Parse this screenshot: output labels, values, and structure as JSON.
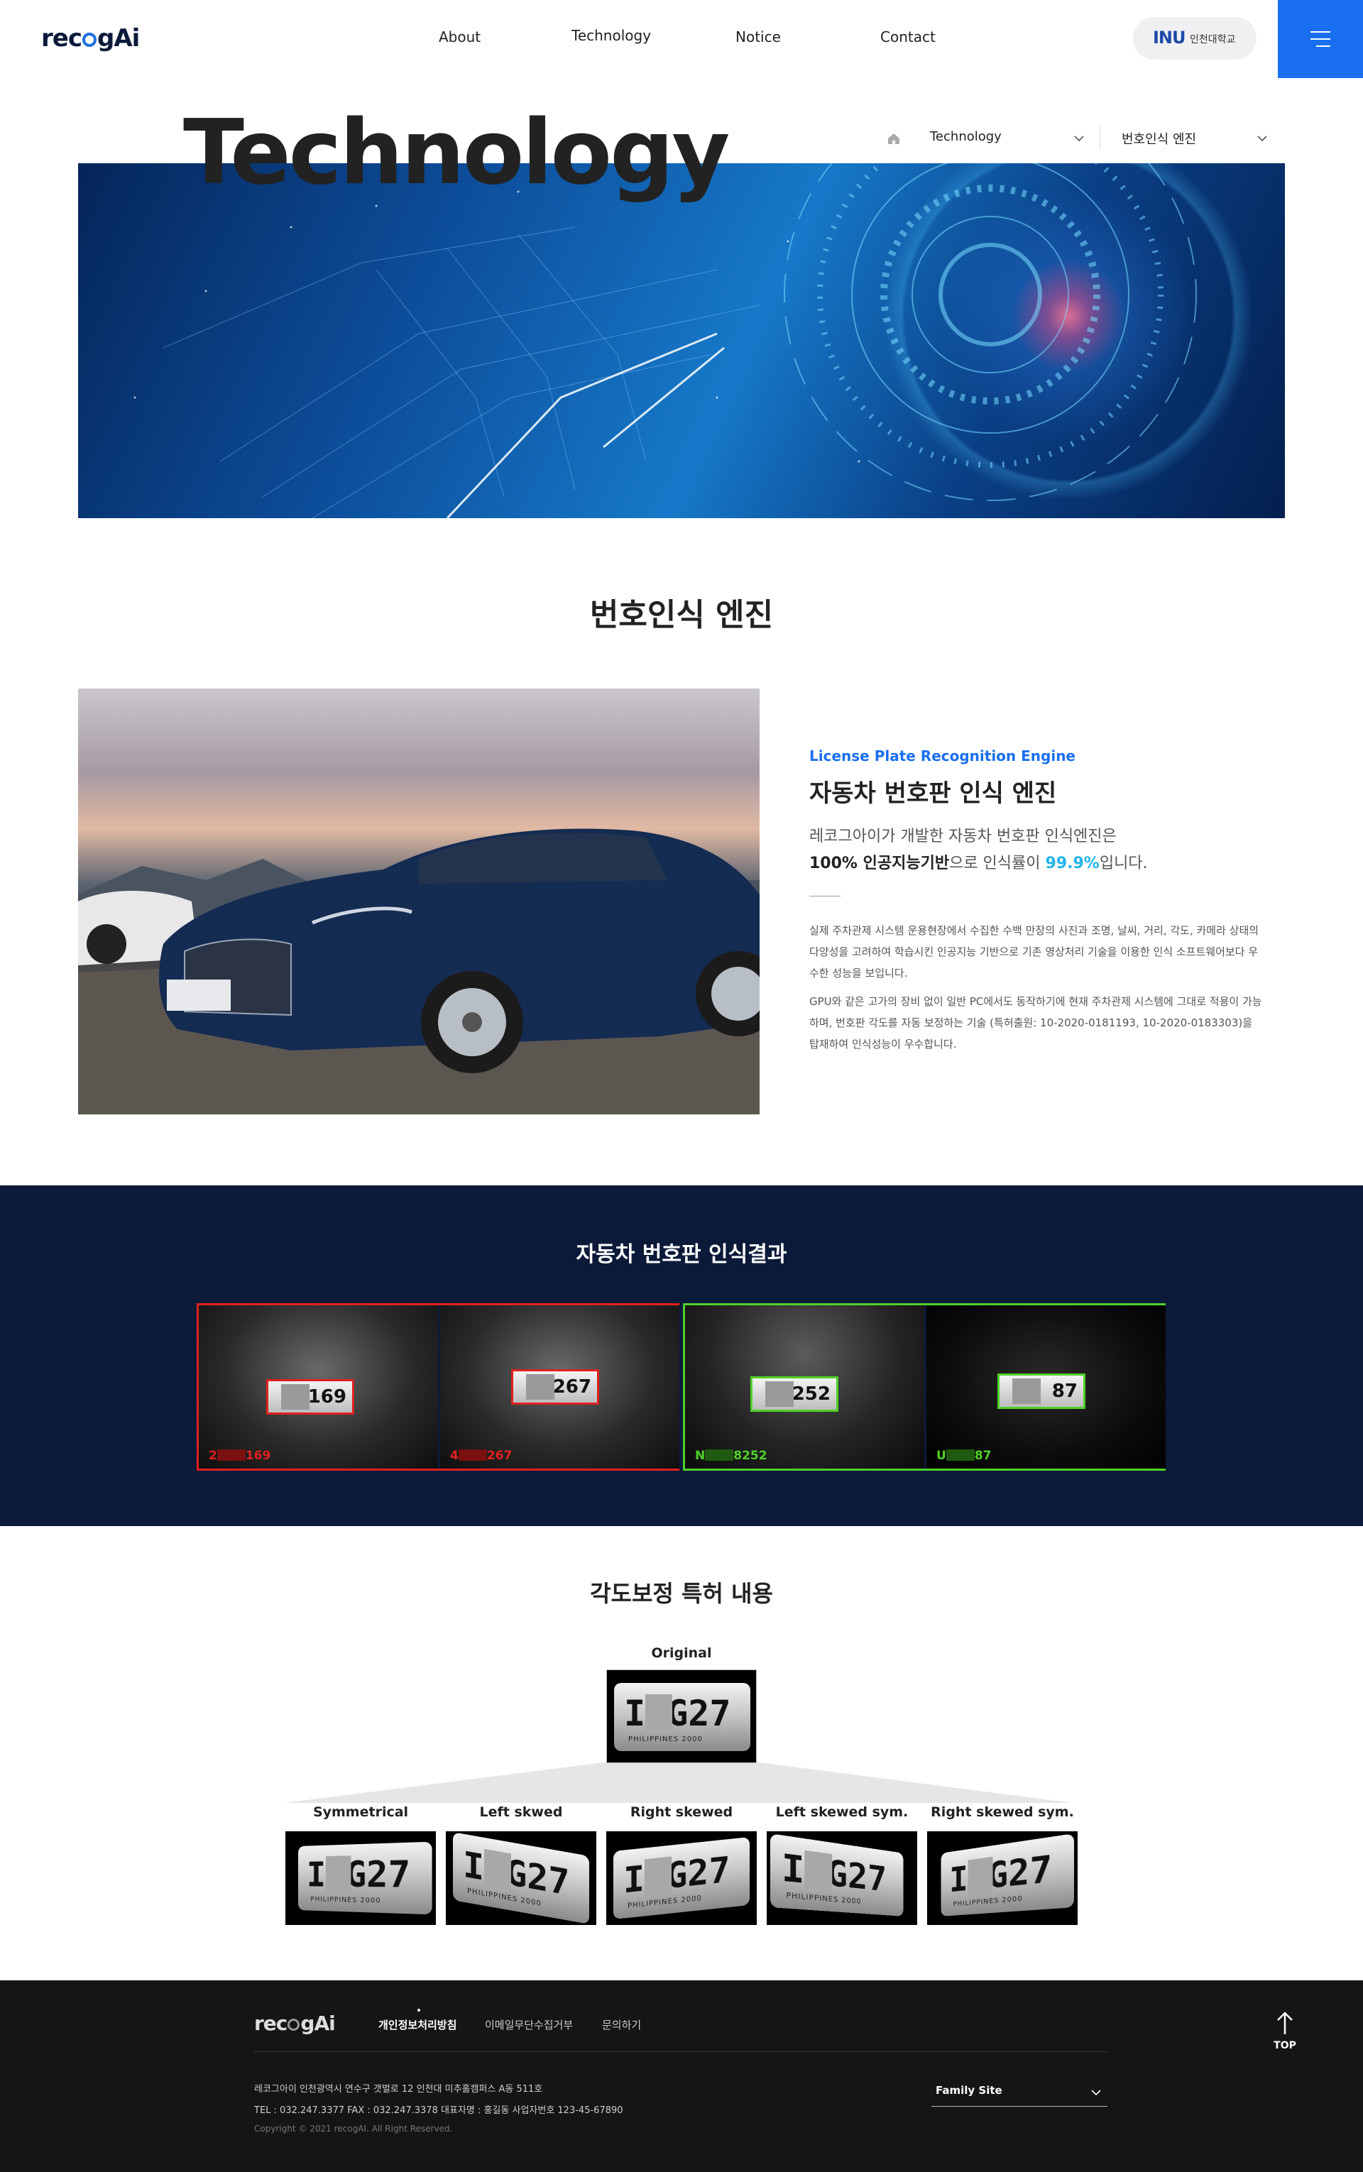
{
  "header": {
    "logo_text_a": "rec",
    "logo_text_b": "gAi",
    "nav": [
      "About",
      "Technology",
      "Notice",
      "Contact"
    ],
    "university_mark": "INU",
    "university_name": "인천대학교",
    "menu_icon": "hamburger-icon"
  },
  "hero": {
    "title": "Technology",
    "breadcrumb": {
      "home_icon": "home-icon",
      "level1": "Technology",
      "level2": "번호인식 엔진"
    }
  },
  "engine": {
    "section_title": "번호인식 엔진",
    "subtitle": "License Plate Recognition Engine",
    "title": "자동차 번호판 인식 엔진",
    "lead_1": "레코그아이가 개발한 자동차 번호판 인식엔진은",
    "lead_2_bold": "100% 인공지능기반",
    "lead_2_mid": "으로 인식률이 ",
    "lead_2_hl": "99.9%",
    "lead_2_end": "입니다.",
    "para_1": "실제 주차관제 시스템 운용현장에서 수집한 수백 만장의 사진과 조명, 날씨, 거리, 각도, 카메라 상태의 다양성을 고려하여 학습시킨 인공지능 기반으로 기존 영상처리 기술을 이용한 인식 소프트웨어보다 우수한 성능을 보입니다.",
    "para_2": "GPU와 같은 고가의 장비 없이 일반 PC에서도 동작하기에 현재 주차관제 시스템에 그대로 적용이 가능하며, 번호판 각도를 자동 보정하는 기술 (특허출원: 10-2020-0181193, 10-2020-0183303)을 탑재하여 인식성능이 우수합니다."
  },
  "results": {
    "title": "자동차 번호판 인식결과",
    "red_color": "#e02020",
    "green_color": "#4fd12a",
    "tiles": [
      {
        "plate_text": "2   169",
        "label_a": "2",
        "label_b": "169",
        "group": "red"
      },
      {
        "plate_text": "4   267",
        "label_a": "4",
        "label_b": "267",
        "group": "red"
      },
      {
        "plate_text": "N   8252",
        "label_a": "N",
        "label_b": "8252",
        "group": "green"
      },
      {
        "plate_text": "U   87",
        "label_a": "U",
        "label_b": "87",
        "group": "green"
      }
    ]
  },
  "patent": {
    "title": "각도보정 특허 내용",
    "original_label": "Original",
    "plate_big": "I G27",
    "plate_small": "PHILIPPINES 2000",
    "variants": [
      "Symmetrical",
      "Left skwed",
      "Right skewed",
      "Left skewed sym.",
      "Right skewed sym."
    ]
  },
  "footer": {
    "logo_text_a": "rec",
    "logo_text_b": "gAi",
    "links": [
      "개인정보처리방침",
      "이메일무단수집거부",
      "문의하기"
    ],
    "address": "레코그아이    인천광역시 연수구 갯벌로 12 인천대 미추홀캠퍼스 A동 511호",
    "contact": "TEL : 032.247.3377     FAX : 032.247.3378     대표자명 : 홍길동     사업자번호 123-45-67890",
    "copyright": "Copyright © 2021 recogAI. All Right Reserved.",
    "family_site": "Family Site",
    "top_label": "TOP"
  }
}
